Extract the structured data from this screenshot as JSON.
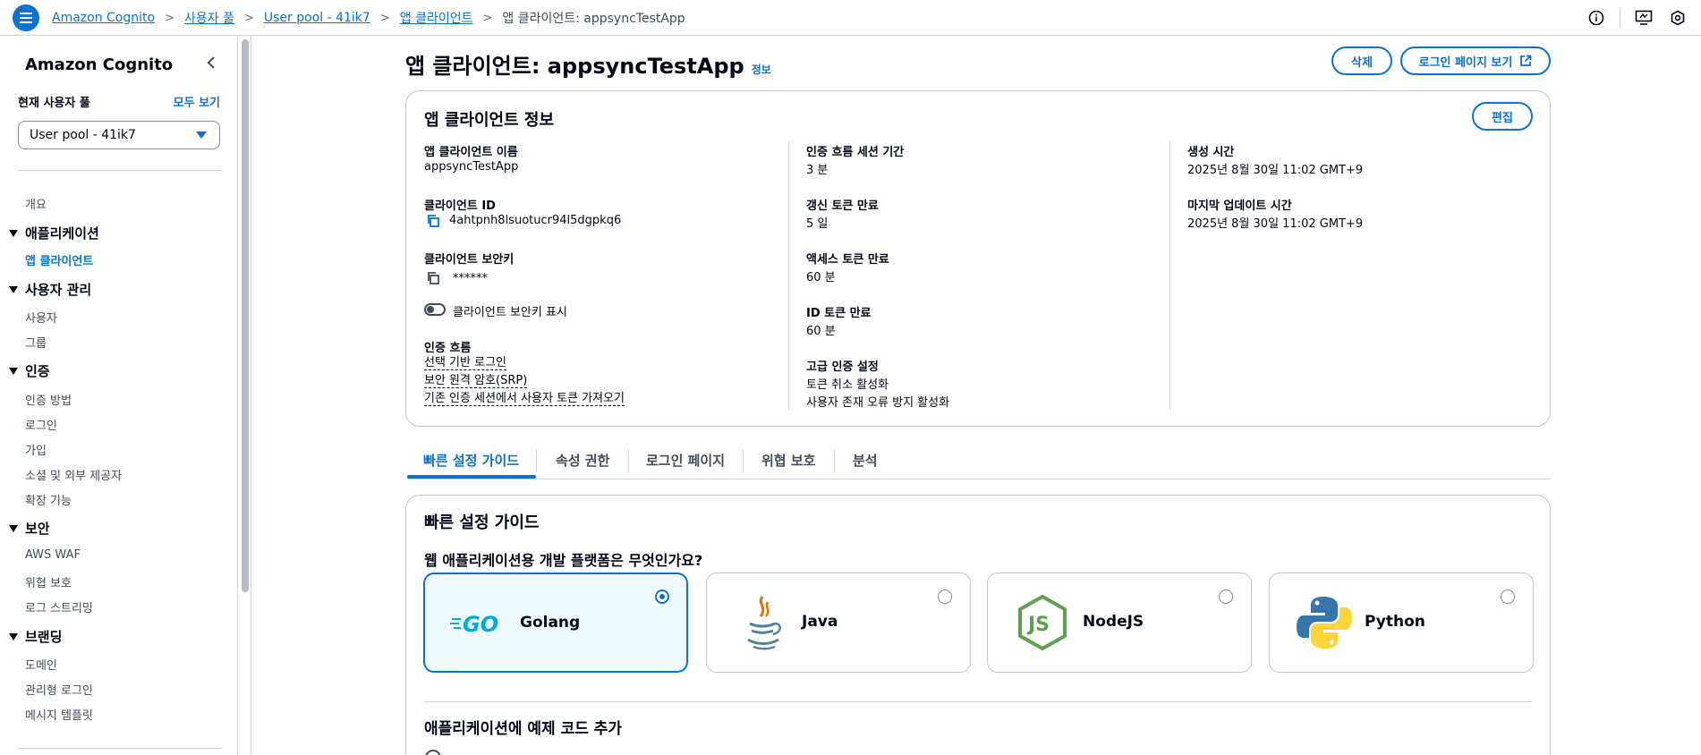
{
  "breadcrumb": {
    "items": [
      "Amazon Cognito",
      "사용자 풀",
      "User pool - 41ik7",
      "앱 클라이언트"
    ],
    "current": "앱 클라이언트: appsyncTestApp"
  },
  "sidebar": {
    "title": "Amazon Cognito",
    "current_pool_label": "현재 사용자 풀",
    "view_all": "모두 보기",
    "pool_select_value": "User pool - 41ik7",
    "overview": "개요",
    "sections": [
      {
        "title": "애플리케이션",
        "items": [
          "앱 클라이언트"
        ]
      },
      {
        "title": "사용자 관리",
        "items": [
          "사용자",
          "그룹"
        ]
      },
      {
        "title": "인증",
        "items": [
          "인증 방법",
          "로그인",
          "가입",
          "소셜 및 외부 제공자",
          "확장 기능"
        ]
      },
      {
        "title": "보안",
        "items": [
          "AWS WAF",
          "위협 보호",
          "로그 스트리밍"
        ]
      },
      {
        "title": "브랜딩",
        "items": [
          "도메인",
          "관리형 로그인",
          "메시지 템플릿"
        ]
      }
    ]
  },
  "page": {
    "title": "앱 클라이언트: appsyncTestApp",
    "info": "정보",
    "delete_btn": "삭제",
    "view_login_btn": "로그인 페이지 보기"
  },
  "info_card": {
    "title": "앱 클라이언트 정보",
    "edit_btn": "편집",
    "col1": {
      "name_label": "앱 클라이언트 이름",
      "name_value": "appsyncTestApp",
      "client_id_label": "클라이언트 ID",
      "client_id_value": "4ahtpnh8lsuotucr94l5dgpkq6",
      "secret_label": "클라이언트 보안키",
      "secret_value": "******",
      "show_secret_label": "클라이언트 보안키 표시",
      "auth_flow_label": "인증 흐름",
      "auth_flows": [
        "선택 기반 로그인",
        "보안 원격 암호(SRP)",
        "기존 인증 세션에서 사용자 토큰 가져오기"
      ]
    },
    "col2": {
      "session_label": "인증 흐름 세션 기간",
      "session_value": "3 분",
      "refresh_label": "갱신 토큰 만료",
      "refresh_value": "5 일",
      "access_label": "액세스 토큰 만료",
      "access_value": "60 분",
      "id_label": "ID 토큰 만료",
      "id_value": "60 분",
      "advanced_label": "고급 인증 설정",
      "advanced_values": [
        "토큰 취소 활성화",
        "사용자 존재 오류 방지 활성화"
      ]
    },
    "col3": {
      "created_label": "생성 시간",
      "created_value": "2025년 8월 30일 11:02 GMT+9",
      "updated_label": "마지막 업데이트 시간",
      "updated_value": "2025년 8월 30일 11:02 GMT+9"
    }
  },
  "tabs": [
    "빠른 설정 가이드",
    "속성 권한",
    "로그인 페이지",
    "위협 보호",
    "분석"
  ],
  "quick_setup": {
    "title": "빠른 설정 가이드",
    "question": "웹 애플리케이션용 개발 플랫폼은 무엇인가요?",
    "platforms": [
      "Golang",
      "Java",
      "NodeJS",
      "Python"
    ],
    "selected_platform": "Golang",
    "add_code_title": "애플리케이션에 예제 코드 추가"
  },
  "colors": {
    "accent": "#0972d3",
    "text": "#000716",
    "border": "#c6c6cd"
  }
}
